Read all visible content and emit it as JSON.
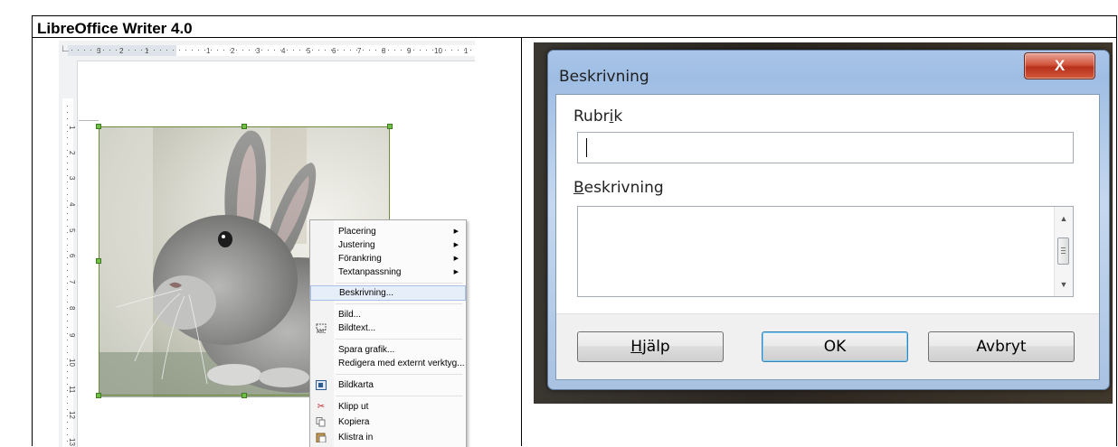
{
  "title": "LibreOffice Writer 4.0",
  "ruler": {
    "horizontal_labels": [
      "3",
      "2",
      "1",
      "1",
      "2",
      "3",
      "4",
      "5",
      "6",
      "7",
      "8",
      "9",
      "10",
      "1"
    ],
    "vertical_labels": [
      "1",
      "2",
      "3",
      "4",
      "5",
      "6",
      "7",
      "8",
      "9",
      "10",
      "11",
      "12",
      "13"
    ]
  },
  "context_menu": {
    "items": [
      {
        "label": "Placering",
        "submenu": true
      },
      {
        "label": "Justering",
        "submenu": true
      },
      {
        "label": "Förankring",
        "submenu": true
      },
      {
        "label": "Textanpassning",
        "submenu": true
      },
      {
        "label": "Beskrivning...",
        "highlighted": true
      },
      {
        "label": "Bild..."
      },
      {
        "label": "Bildtext...",
        "icon": "caption-icon"
      },
      {
        "label": "Spara grafik..."
      },
      {
        "label": "Redigera med externt verktyg..."
      },
      {
        "label": "Bildkarta",
        "icon": "image-map-icon"
      },
      {
        "label": "Klipp ut",
        "icon": "scissors-icon"
      },
      {
        "label": "Kopiera",
        "icon": "copy-icon"
      },
      {
        "label": "Klistra in",
        "icon": "paste-icon"
      }
    ]
  },
  "dialog": {
    "title": "Beskrivning",
    "close_glyph": "X",
    "rubrik_label_pre": "Rubr",
    "rubrik_label_u": "i",
    "rubrik_label_post": "k",
    "rubrik_value": "",
    "beskrivning_label_u": "B",
    "beskrivning_label_post": "eskrivning",
    "beskrivning_value": "",
    "help_u": "H",
    "help_post": "jälp",
    "ok_label": "OK",
    "cancel_label": "Avbryt"
  }
}
